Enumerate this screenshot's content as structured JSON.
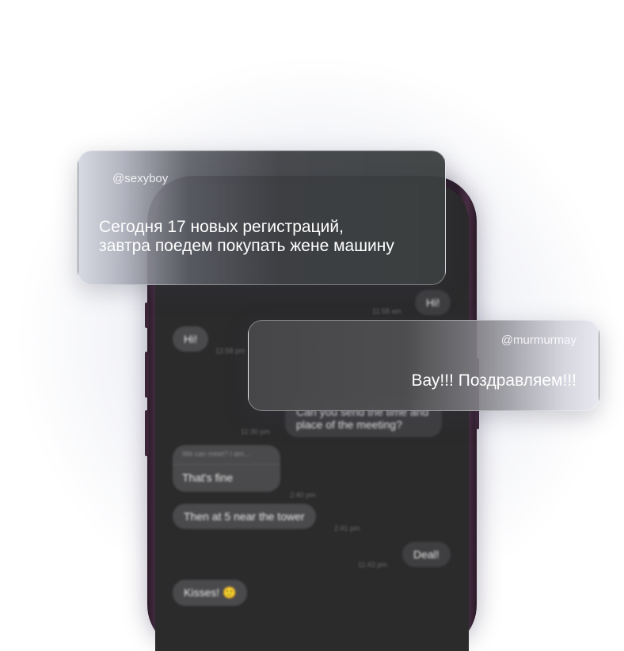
{
  "notifications": [
    {
      "username": "@sexyboy",
      "line1": "Сегодня 17 новых регистраций,",
      "line2": "завтра поедем покупать жене машину"
    },
    {
      "username": "@murmurmay",
      "text": "Вау!!! Поздравляем!!!"
    }
  ],
  "chat": {
    "messages": [
      {
        "text": "Hi!",
        "time": "11:58 am"
      },
      {
        "text": "Hi!",
        "time": "12:58 pm"
      },
      {
        "text1": "Can you send the time and",
        "text2": "place of the meeting?",
        "time": "11:30 pm"
      },
      {
        "quote": "We can meet? I am...",
        "text": "That's fine",
        "time": "2:40 pm"
      },
      {
        "text": "Then at 5 near the tower",
        "time": "2:41 pm"
      },
      {
        "text": "Deal!",
        "time": "11:43 pm"
      },
      {
        "text": "Kisses! 🙂"
      }
    ]
  },
  "colors": {
    "phone_frame": "#2b1c2a",
    "screen": "#2b2b2c"
  }
}
